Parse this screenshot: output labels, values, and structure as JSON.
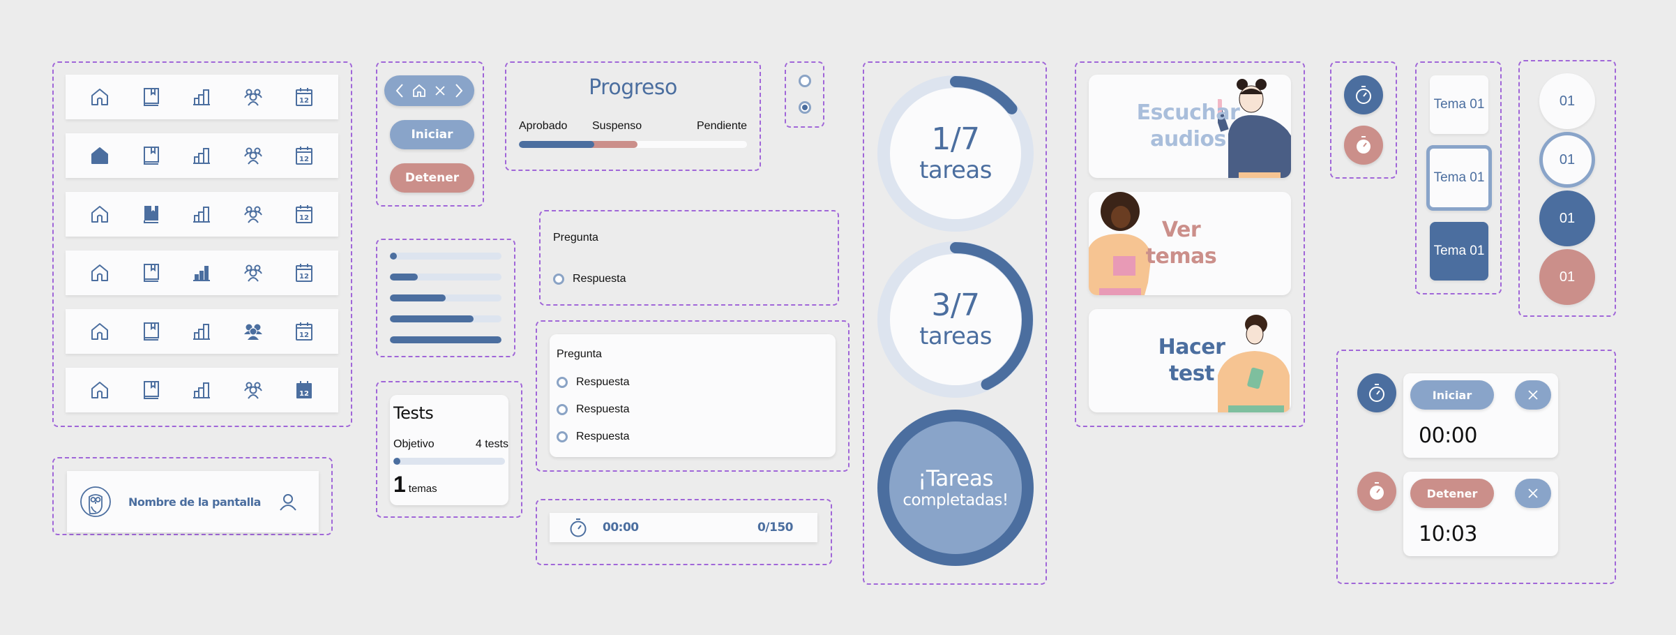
{
  "colors": {
    "background": "#ececec",
    "primary": "#4b6e9f",
    "primary_light": "#89a4c9",
    "track": "#dde4ef",
    "danger": "#cb8f8a",
    "frame_border": "#a066d8",
    "card": "#fbfbfc"
  },
  "navbars": [
    {
      "active": "home",
      "items": [
        "home-icon",
        "book-icon",
        "stats-icon",
        "group-icon",
        "calendar-icon"
      ]
    },
    {
      "active": "home"
    },
    {
      "active": "book"
    },
    {
      "active": "stats"
    },
    {
      "active": "group"
    },
    {
      "active": "calendar"
    }
  ],
  "navbar_states": [
    "none",
    "home",
    "book",
    "stats",
    "group",
    "calendar"
  ],
  "calendar_day": "12",
  "header_bar": {
    "logo": "owl-logo-icon",
    "title": "Nombre de la pantalla",
    "user_icon": "user-icon"
  },
  "button_group": {
    "nav_pill_icons": [
      "chevron-left-icon",
      "home-icon",
      "close-icon",
      "chevron-right-icon"
    ],
    "start_label": "Iniciar",
    "stop_label": "Detener"
  },
  "progreso": {
    "title": "Progreso",
    "labels": [
      "Aprobado",
      "Suspenso",
      "Pendiente"
    ],
    "aprobado_fraction": 0.33,
    "suspenso_fraction": 0.19,
    "pendiente_fraction": 0.48
  },
  "radio_states": [
    {
      "checked": false
    },
    {
      "checked": true
    }
  ],
  "progress_levels": [
    0.03,
    0.25,
    0.5,
    0.75,
    1.0
  ],
  "tests_card": {
    "title": "Tests",
    "goal_label": "Objetivo",
    "goal_value": "4 tests",
    "progress": 0.03,
    "count": "1",
    "count_unit": "temas"
  },
  "question_single": {
    "question": "Pregunta",
    "answers": [
      "Respuesta"
    ]
  },
  "question_multi": {
    "question": "Pregunta",
    "answers": [
      "Respuesta",
      "Respuesta",
      "Respuesta"
    ]
  },
  "timer_bar": {
    "icon": "stopwatch-icon",
    "time": "00:00",
    "counter": "0/150"
  },
  "task_rings": [
    {
      "value": "1/7",
      "unit": "tareas",
      "done": 1,
      "total": 7
    },
    {
      "value": "3/7",
      "unit": "tareas",
      "done": 3,
      "total": 7
    }
  ],
  "tasks_complete": {
    "line1": "¡Tareas",
    "line2": "completadas!"
  },
  "action_cards": [
    {
      "line1": "Escuchar",
      "line2": "audios",
      "color": "#a9bedb",
      "illustration": "person-with-phone-illustration"
    },
    {
      "line1": "Ver",
      "line2": "temas",
      "color": "#cb8f8a",
      "illustration": "person-reading-illustration"
    },
    {
      "line1": "Hacer",
      "line2": "test",
      "color": "#4b6e9f",
      "illustration": "person-with-tablet-illustration"
    }
  ],
  "timer_icons": [
    "stopwatch-idle",
    "stopwatch-running"
  ],
  "tema_buttons": [
    {
      "label": "Tema 01",
      "state": "default"
    },
    {
      "label": "Tema 01",
      "state": "selected"
    },
    {
      "label": "Tema 01",
      "state": "active"
    }
  ],
  "number_circles": [
    {
      "label": "01",
      "state": "default"
    },
    {
      "label": "01",
      "state": "selected"
    },
    {
      "label": "01",
      "state": "active"
    },
    {
      "label": "01",
      "state": "danger"
    }
  ],
  "timer_widgets": [
    {
      "button": "Iniciar",
      "time": "00:00",
      "state": "idle"
    },
    {
      "button": "Detener",
      "time": "10:03",
      "state": "running"
    }
  ]
}
